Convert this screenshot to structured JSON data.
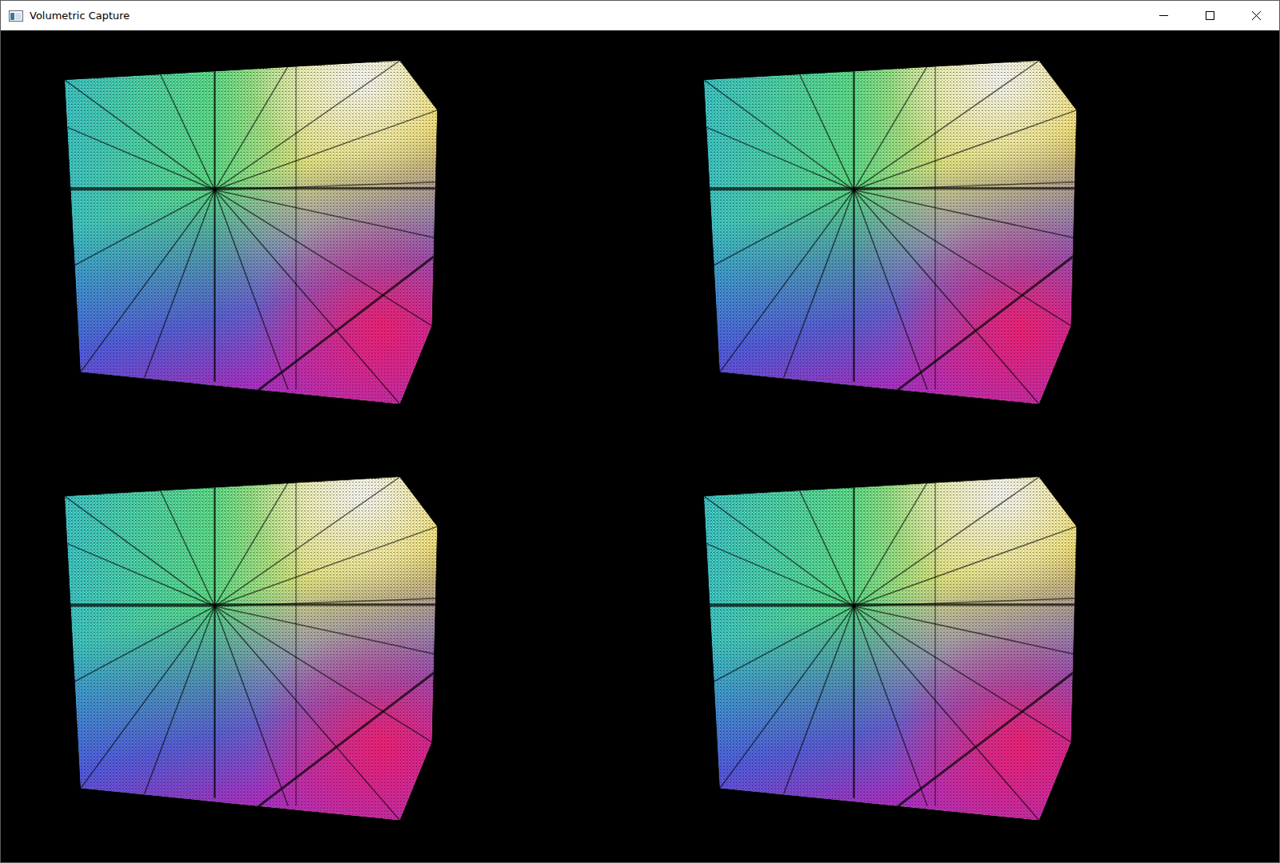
{
  "window": {
    "title": "Volumetric Capture"
  },
  "viewports": [
    {
      "kind": "point-cloud"
    },
    {
      "kind": "point-cloud"
    },
    {
      "kind": "point-cloud"
    },
    {
      "kind": "point-cloud"
    }
  ]
}
